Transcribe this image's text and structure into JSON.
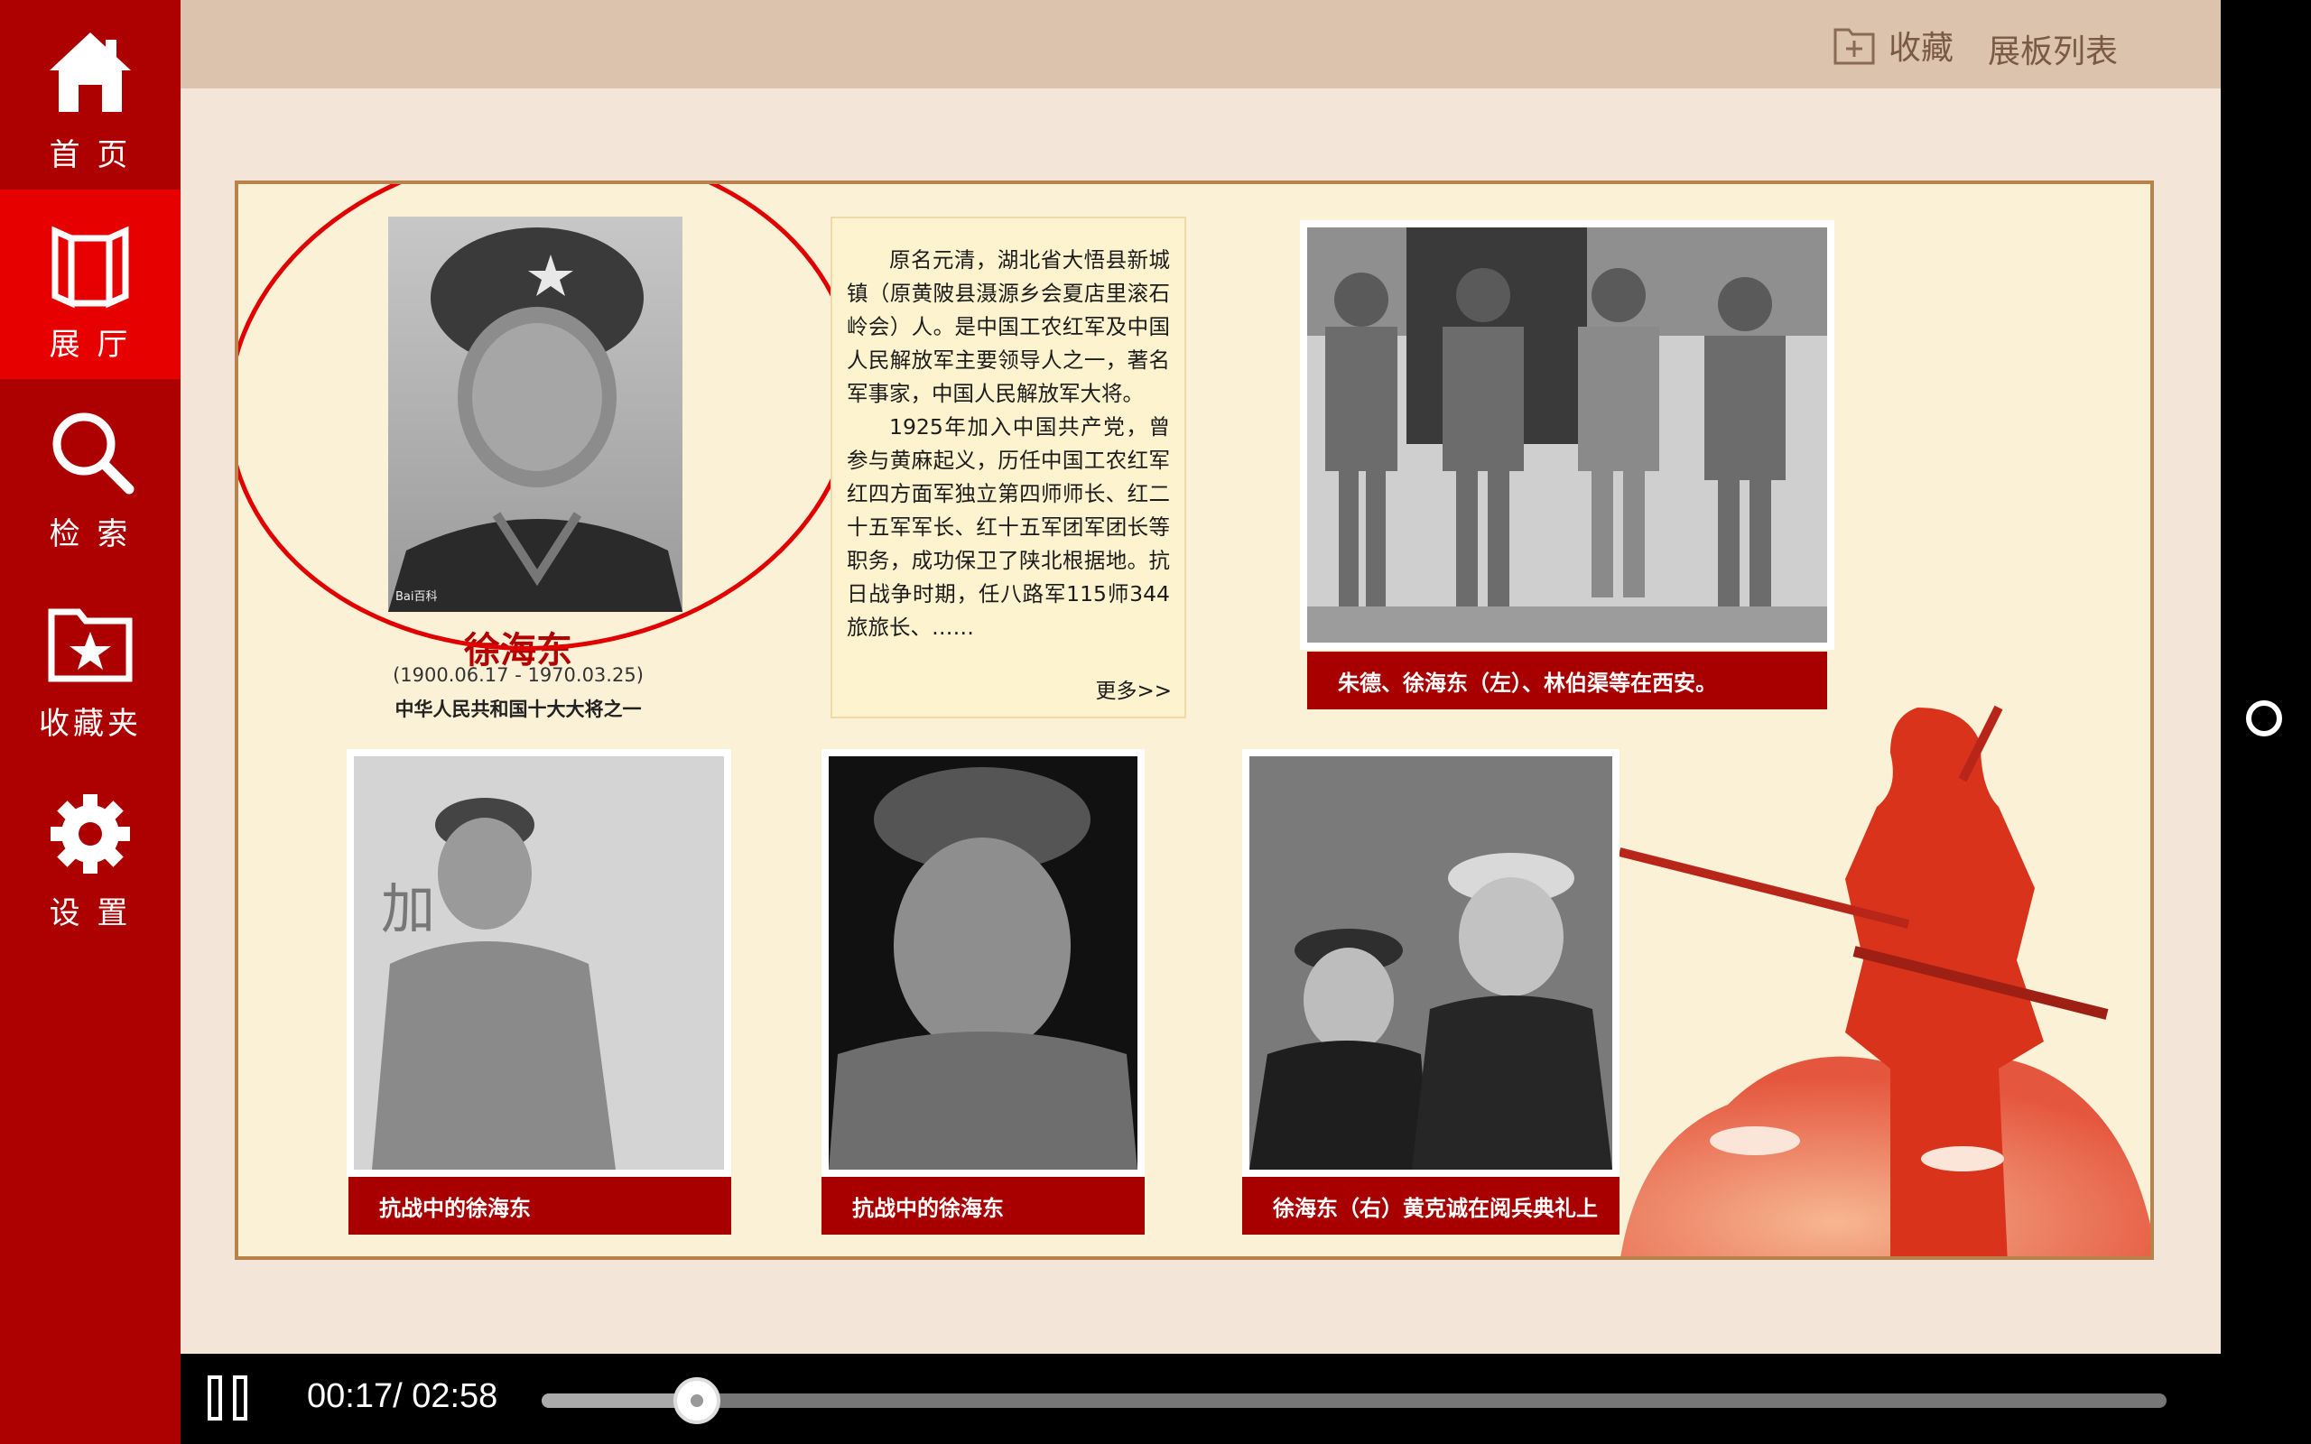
{
  "sidebar": {
    "items": [
      {
        "label": "首 页",
        "icon": "home-icon"
      },
      {
        "label": "展 厅",
        "icon": "exhibition-icon",
        "active": true
      },
      {
        "label": "检 索",
        "icon": "search-icon"
      },
      {
        "label": "收藏夹",
        "icon": "favorites-folder-icon"
      },
      {
        "label": "设 置",
        "icon": "gear-icon"
      }
    ]
  },
  "topbar": {
    "favorite_label": "收藏",
    "panel_list_label": "展板列表"
  },
  "exhibit": {
    "name": "徐海东",
    "dates": "(1900.06.17 - 1970.03.25)",
    "subtitle": "中华人民共和国十大大将之一",
    "bio_p1": "原名元清，湖北省大悟县新城镇（原黄陂县滠源乡会夏店里滚石岭会）人。是中国工农红军及中国人民解放军主要领导人之一，著名军事家，中国人民解放军大将。",
    "bio_p2": "1925年加入中国共产党，曾参与黄麻起义，历任中国工农红军红四方面军独立第四师师长、红二十五军军长、红十五军团军团长等职务，成功保卫了陕北根据地。抗日战争时期，任八路军115师344旅旅长、……",
    "more": "更多>>",
    "captions": {
      "group": "朱德、徐海东（左）、林伯渠等在西安。",
      "war1": "抗战中的徐海东",
      "war2": "抗战中的徐海东",
      "parade": "徐海东（右）黄克诚在阅兵典礼上"
    },
    "watermark": "Bai百科"
  },
  "player": {
    "current": "00:17",
    "total": "02:58",
    "time_display": "00:17/ 02:58",
    "progress": 0.0955
  },
  "colors": {
    "sidebar": "#ad0000",
    "active": "#e60000",
    "caption": "#a80000",
    "panel": "#fbf1d7"
  }
}
